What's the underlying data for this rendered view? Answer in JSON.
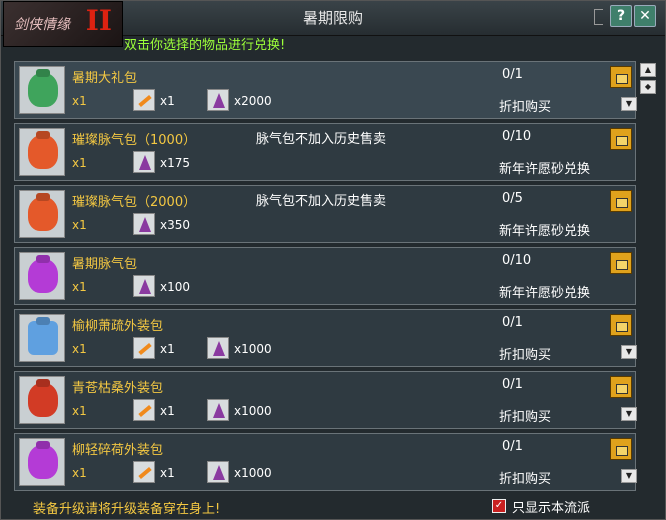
{
  "window": {
    "title": "暑期限购",
    "hint": "双击你选择的物品进行兑换!",
    "logo_text": "剑侠情缘",
    "logo_mark": "II",
    "help_label": "?",
    "close_label": "✕"
  },
  "items": [
    {
      "name": "暑期大礼包",
      "note": "",
      "qty": "x1",
      "costs": [
        {
          "icon": "carrot-icon",
          "text": "x1"
        },
        {
          "icon": "gem-icon",
          "text": "x2000"
        }
      ],
      "limit": "0/1",
      "action": "折扣购买",
      "has_dropdown": true,
      "bag": "green"
    },
    {
      "name": "璀璨脉气包（1000）",
      "note": "脉气包不加入历史售卖",
      "qty": "x1",
      "costs": [
        {
          "icon": "gem-icon",
          "text": "x175"
        }
      ],
      "limit": "0/10",
      "action": "新年许愿砂兑换",
      "has_dropdown": false,
      "bag": "orange"
    },
    {
      "name": "璀璨脉气包（2000）",
      "note": "脉气包不加入历史售卖",
      "qty": "x1",
      "costs": [
        {
          "icon": "gem-icon",
          "text": "x350"
        }
      ],
      "limit": "0/5",
      "action": "新年许愿砂兑换",
      "has_dropdown": false,
      "bag": "orange"
    },
    {
      "name": "暑期脉气包",
      "note": "",
      "qty": "x1",
      "costs": [
        {
          "icon": "gem-icon",
          "text": "x100"
        }
      ],
      "limit": "0/10",
      "action": "新年许愿砂兑换",
      "has_dropdown": false,
      "bag": "purple"
    },
    {
      "name": "榆柳萧疏外装包",
      "note": "",
      "qty": "x1",
      "costs": [
        {
          "icon": "carrot-icon",
          "text": "x1"
        },
        {
          "icon": "gem-icon",
          "text": "x1000"
        }
      ],
      "limit": "0/1",
      "action": "折扣购买",
      "has_dropdown": true,
      "bag": "blue"
    },
    {
      "name": "青苍枯桑外装包",
      "note": "",
      "qty": "x1",
      "costs": [
        {
          "icon": "carrot-icon",
          "text": "x1"
        },
        {
          "icon": "gem-icon",
          "text": "x1000"
        }
      ],
      "limit": "0/1",
      "action": "折扣购买",
      "has_dropdown": true,
      "bag": "red"
    },
    {
      "name": "柳轻碎荷外装包",
      "note": "",
      "qty": "x1",
      "costs": [
        {
          "icon": "carrot-icon",
          "text": "x1"
        },
        {
          "icon": "gem-icon",
          "text": "x1000"
        }
      ],
      "limit": "0/1",
      "action": "折扣购买",
      "has_dropdown": true,
      "bag": "purple"
    }
  ],
  "footer": {
    "note": "装备升级请将升级装备穿在身上!",
    "filter_label": "只显示本流派",
    "filter_checked": true
  }
}
